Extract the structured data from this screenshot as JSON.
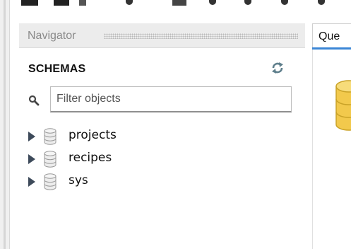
{
  "colors": {
    "panel_header_bg": "#ececec",
    "tab_accent": "#3a86d6",
    "db_icon_gold": "#f2c94c",
    "tree_arrow": "#3d4a5a"
  },
  "navigator": {
    "title": "Navigator",
    "section_label": "SCHEMAS",
    "refresh_icon": "refresh-icon",
    "filter": {
      "placeholder": "Filter objects",
      "value": ""
    },
    "schemas": [
      {
        "label": "projects",
        "icon": "database-icon",
        "expanded": false
      },
      {
        "label": "recipes",
        "icon": "database-icon",
        "expanded": false
      },
      {
        "label": "sys",
        "icon": "database-icon",
        "expanded": false
      }
    ]
  },
  "query_panel": {
    "tab_label": "Que"
  }
}
